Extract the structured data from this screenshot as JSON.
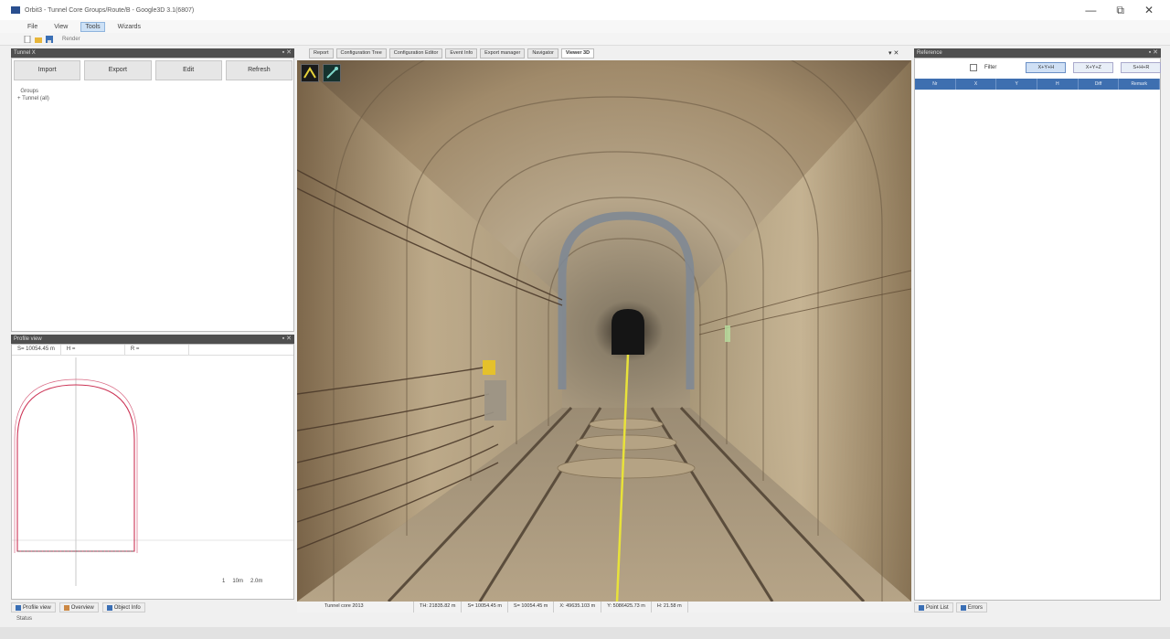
{
  "window": {
    "title": "Orbit3 - Tunnel Core Groups/Route/B - Google3D 3.1(6807)",
    "controls": [
      "—",
      "⧉",
      "✕"
    ]
  },
  "menu": [
    "File",
    "View",
    "Tools",
    "Wizards"
  ],
  "toolbar": {
    "label": "Render"
  },
  "left_top": {
    "title": "Tunnel X",
    "buttons": [
      "Import",
      "Export",
      "Edit",
      "Refresh"
    ],
    "tree": [
      "Groups",
      "Tunnel (all)"
    ]
  },
  "profile": {
    "title": "Profile view",
    "fields": [
      "S= 10054.45 m",
      "H =",
      "R ="
    ],
    "scale": [
      "1",
      "10m",
      "2.0m"
    ]
  },
  "left_tabs": [
    "Profile view",
    "Overview",
    "Object Info"
  ],
  "center_tabs": [
    "Report",
    "Configuration Tree",
    "Configuration Editor",
    "Event Info",
    "Export manager",
    "Navigator",
    "Viewer 3D"
  ],
  "center_pin": "▾ ✕",
  "viewer_status": [
    "Tunnel core 2013",
    "TH: 21835.82 m",
    "S= 10054.45 m",
    "S= 10054.45 m",
    "X: 49635.103 m",
    "Y: 5086425.73 m",
    "H: 21.58 m"
  ],
  "right_panel": {
    "title": "Reference",
    "checkbox_label": "Filter",
    "buttons": [
      "X+Y+H",
      "X+Y+Z",
      "S+H+R"
    ],
    "columns": [
      "Nr",
      "X",
      "Y",
      "H",
      "Diff",
      "Remark"
    ]
  },
  "right_tabs": [
    "Point List",
    "Errors"
  ],
  "status": "Status"
}
